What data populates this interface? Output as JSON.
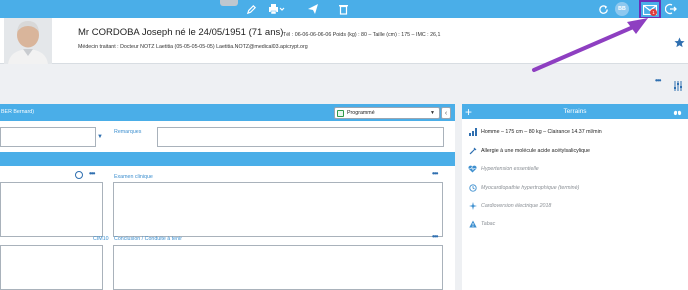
{
  "toolbar": {
    "icons": [
      "pencil-icon",
      "printer-icon",
      "send-icon",
      "trash-icon",
      "refresh-icon",
      "user-initials-badge",
      "mail-icon",
      "logout-icon"
    ],
    "user_initials": "BB",
    "mail_count": "1"
  },
  "patient": {
    "name_line": "Mr CORDOBA Joseph né le 24/05/1951 (71 ans)",
    "meta_line": "Tél : 06-06-06-06-06   Poids (kg) : 80 – Taille (cm) : 175 –   IMC : 26,1",
    "doctor_line": "Médecin traitant : Docteur NOTZ Laetitia (05-05-05-05-05) Laetitia.NOTZ@medical03.apicrypt.org"
  },
  "consult": {
    "practitioner": "BER Bernard)",
    "status_select": "Programmé",
    "remarks_label": "Remarques",
    "exam_label": "Examen clinique",
    "cim_label": "CIM10",
    "conclusion_label": "Conclusion / Conduite à tenir"
  },
  "terrains": {
    "title": "Terrains",
    "items": [
      {
        "icon": "bar-chart-icon",
        "text": "Homme – 175 cm – 80 kg – Clairance 14.37 ml/min",
        "style": "normal"
      },
      {
        "icon": "syringe-icon",
        "text": "Allergie à une molécule acide acétylsalicylique",
        "style": "normal"
      },
      {
        "icon": "heart-icon",
        "text": "Hypertension essentielle",
        "style": "italic"
      },
      {
        "icon": "history-icon",
        "text": "Myocardiopathie hypertrophique (terminé)",
        "style": "italic"
      },
      {
        "icon": "sparkle-icon",
        "text": "Cardioversion électrique 2018",
        "style": "italic"
      },
      {
        "icon": "warning-icon",
        "text": "Tabac",
        "style": "italic"
      }
    ]
  },
  "colors": {
    "accent": "#4aaee8",
    "annotation_arrow": "#8e3fc1",
    "link": "#3d8fcf"
  }
}
